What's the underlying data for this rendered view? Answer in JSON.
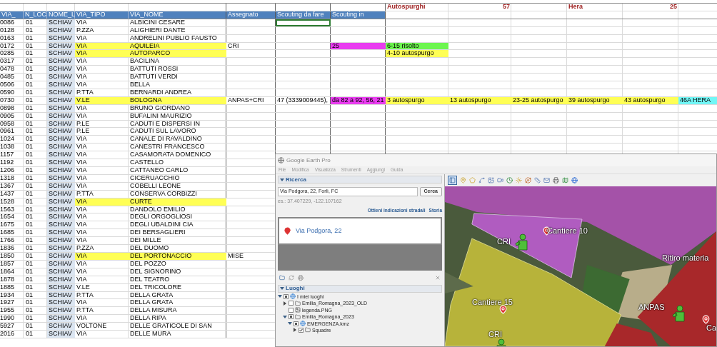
{
  "sheet": {
    "summary": [
      {
        "label": "Autospurghi",
        "count": "57"
      },
      {
        "label": "Hera",
        "count": "25"
      }
    ],
    "columns": [
      "VIA_",
      "N_LOC",
      "NOME_L",
      "VIA_TIPO",
      "VIA_NOME",
      "Assegnato",
      "Scouting da fare",
      "Scouting in"
    ],
    "rows": [
      {
        "codice": "0086",
        "loc": "01",
        "nome": "SCHIAV",
        "tipo": "VIA",
        "via": "ALBICINI CESARE",
        "highlighted": false,
        "selected": true
      },
      {
        "codice": "0128",
        "loc": "01",
        "nome": "SCHIAV",
        "tipo": "P.ZZA",
        "via": "ALIGHIERI DANTE",
        "highlighted": false,
        "selected": false
      },
      {
        "codice": "0163",
        "loc": "01",
        "nome": "SCHIAV",
        "tipo": "VIA",
        "via": "ANDRELINI PUBLIO FAUSTO",
        "highlighted": false,
        "selected": false
      },
      {
        "codice": "0172",
        "loc": "01",
        "nome": "SCHIAV",
        "tipo": "VIA",
        "via": "AQUILEIA",
        "highlighted": true,
        "selected": false,
        "assegnato": "CRI",
        "scouting_in": "25",
        "interventi": [
          {
            "text": "6-15 risolto",
            "color": "#6df64f"
          }
        ]
      },
      {
        "codice": "0285",
        "loc": "01",
        "nome": "SCHIAV",
        "tipo": "VIA",
        "via": "AUTOPARCO",
        "highlighted": true,
        "selected": false,
        "interventi": [
          {
            "text": "4-10 autospurgo",
            "color": "#ffff55"
          }
        ]
      },
      {
        "codice": "0317",
        "loc": "01",
        "nome": "SCHIAV",
        "tipo": "VIA",
        "via": "BACILINA",
        "highlighted": false,
        "selected": false
      },
      {
        "codice": "0478",
        "loc": "01",
        "nome": "SCHIAV",
        "tipo": "VIA",
        "via": "BATTUTI ROSSI",
        "highlighted": false,
        "selected": false
      },
      {
        "codice": "0485",
        "loc": "01",
        "nome": "SCHIAV",
        "tipo": "VIA",
        "via": "BATTUTI VERDI",
        "highlighted": false,
        "selected": false
      },
      {
        "codice": "0506",
        "loc": "01",
        "nome": "SCHIAV",
        "tipo": "VIA",
        "via": "BELLA",
        "highlighted": false,
        "selected": false
      },
      {
        "codice": "0590",
        "loc": "01",
        "nome": "SCHIAV",
        "tipo": "P.TTA",
        "via": "BERNARDI ANDREA",
        "highlighted": false,
        "selected": false
      },
      {
        "codice": "0730",
        "loc": "01",
        "nome": "SCHIAV",
        "tipo": "V.LE",
        "via": "BOLOGNA",
        "highlighted": true,
        "selected": false,
        "assegnato": "ANPAS+CRI",
        "da_fare": "47 (3339009445),",
        "scouting_in": "da 82 a 92, 56, 21",
        "interventi": [
          {
            "text": "3 autospurgo",
            "color": "#ffff55"
          },
          {
            "text": "13 autospurgo",
            "color": "#ffff55"
          },
          {
            "text": "23-25 autospurgo",
            "color": "#ffff55"
          },
          {
            "text": "39 autospurgo",
            "color": "#ffff55"
          },
          {
            "text": "43 autospurgo",
            "color": "#ffff55"
          },
          {
            "text": "46A HERA",
            "color": "#72f6f6"
          }
        ]
      },
      {
        "codice": "0898",
        "loc": "01",
        "nome": "SCHIAV",
        "tipo": "VIA",
        "via": "BRUNO GIORDANO",
        "highlighted": false,
        "selected": false
      },
      {
        "codice": "0905",
        "loc": "01",
        "nome": "SCHIAV",
        "tipo": "VIA",
        "via": "BUFALINI MAURIZIO",
        "highlighted": false,
        "selected": false
      },
      {
        "codice": "0958",
        "loc": "01",
        "nome": "SCHIAV",
        "tipo": "P.LE",
        "via": "CADUTI E DISPERSI IN",
        "highlighted": false,
        "selected": false
      },
      {
        "codice": "0961",
        "loc": "01",
        "nome": "SCHIAV",
        "tipo": "P.LE",
        "via": "CADUTI SUL LAVORO",
        "highlighted": false,
        "selected": false
      },
      {
        "codice": "1024",
        "loc": "01",
        "nome": "SCHIAV",
        "tipo": "VIA",
        "via": "CANALE DI RAVALDINO",
        "highlighted": false,
        "selected": false
      },
      {
        "codice": "1038",
        "loc": "01",
        "nome": "SCHIAV",
        "tipo": "VIA",
        "via": "CANESTRI FRANCESCO",
        "highlighted": false,
        "selected": false
      },
      {
        "codice": "1157",
        "loc": "01",
        "nome": "SCHIAV",
        "tipo": "VIA",
        "via": "CASAMORATA DOMENICO",
        "highlighted": false,
        "selected": false
      },
      {
        "codice": "1192",
        "loc": "01",
        "nome": "SCHIAV",
        "tipo": "VIA",
        "via": "CASTELLO",
        "highlighted": false,
        "selected": false
      },
      {
        "codice": "1206",
        "loc": "01",
        "nome": "SCHIAV",
        "tipo": "VIA",
        "via": "CATTANEO CARLO",
        "highlighted": false,
        "selected": false
      },
      {
        "codice": "1318",
        "loc": "01",
        "nome": "SCHIAV",
        "tipo": "VIA",
        "via": "CICERUACCHIO",
        "highlighted": false,
        "selected": false
      },
      {
        "codice": "1367",
        "loc": "01",
        "nome": "SCHIAV",
        "tipo": "VIA",
        "via": "COBELLI LEONE",
        "highlighted": false,
        "selected": false
      },
      {
        "codice": "1437",
        "loc": "01",
        "nome": "SCHIAV",
        "tipo": "P.TTA",
        "via": "CONSERVA CORBIZZI",
        "highlighted": false,
        "selected": false
      },
      {
        "codice": "1528",
        "loc": "01",
        "nome": "SCHIAV",
        "tipo": "VIA",
        "via": "CURTE",
        "highlighted": true,
        "selected": false
      },
      {
        "codice": "1563",
        "loc": "01",
        "nome": "SCHIAV",
        "tipo": "VIA",
        "via": "DANDOLO EMILIO",
        "highlighted": false,
        "selected": false
      },
      {
        "codice": "1654",
        "loc": "01",
        "nome": "SCHIAV",
        "tipo": "VIA",
        "via": "DEGLI ORGOGLIOSI",
        "highlighted": false,
        "selected": false
      },
      {
        "codice": "1675",
        "loc": "01",
        "nome": "SCHIAV",
        "tipo": "VIA",
        "via": "DEGLI UBALDINI CIA",
        "highlighted": false,
        "selected": false
      },
      {
        "codice": "1685",
        "loc": "01",
        "nome": "SCHIAV",
        "tipo": "VIA",
        "via": "DEI BERSAGLIERI",
        "highlighted": false,
        "selected": false
      },
      {
        "codice": "1766",
        "loc": "01",
        "nome": "SCHIAV",
        "tipo": "VIA",
        "via": "DEI MILLE",
        "highlighted": false,
        "selected": false
      },
      {
        "codice": "1836",
        "loc": "01",
        "nome": "SCHIAV",
        "tipo": "P.ZZA",
        "via": "DEL DUOMO",
        "highlighted": false,
        "selected": false
      },
      {
        "codice": "1850",
        "loc": "01",
        "nome": "SCHIAV",
        "tipo": "VIA",
        "via": "DEL PORTONACCIO",
        "highlighted": true,
        "selected": false,
        "assegnato": "MISE"
      },
      {
        "codice": "1857",
        "loc": "01",
        "nome": "SCHIAV",
        "tipo": "VIA",
        "via": "DEL POZZO",
        "highlighted": false,
        "selected": false
      },
      {
        "codice": "1864",
        "loc": "01",
        "nome": "SCHIAV",
        "tipo": "VIA",
        "via": "DEL SIGNORINO",
        "highlighted": false,
        "selected": false
      },
      {
        "codice": "1878",
        "loc": "01",
        "nome": "SCHIAV",
        "tipo": "VIA",
        "via": "DEL TEATRO",
        "highlighted": false,
        "selected": false
      },
      {
        "codice": "1885",
        "loc": "01",
        "nome": "SCHIAV",
        "tipo": "V.LE",
        "via": "DEL TRICOLORE",
        "highlighted": false,
        "selected": false
      },
      {
        "codice": "1934",
        "loc": "01",
        "nome": "SCHIAV",
        "tipo": "P.TTA",
        "via": "DELLA GRATA",
        "highlighted": false,
        "selected": false
      },
      {
        "codice": "1927",
        "loc": "01",
        "nome": "SCHIAV",
        "tipo": "VIA",
        "via": "DELLA GRATA",
        "highlighted": false,
        "selected": false
      },
      {
        "codice": "1955",
        "loc": "01",
        "nome": "SCHIAV",
        "tipo": "P.TTA",
        "via": "DELLA MISURA",
        "highlighted": false,
        "selected": false
      },
      {
        "codice": "1990",
        "loc": "01",
        "nome": "SCHIAV",
        "tipo": "VIA",
        "via": "DELLA RIPA",
        "highlighted": false,
        "selected": false
      },
      {
        "codice": "5927",
        "loc": "01",
        "nome": "SCHIAV",
        "tipo": "VOLTONE",
        "via": "DELLE GRATICOLE DI SAN",
        "highlighted": false,
        "selected": false
      },
      {
        "codice": "2016",
        "loc": "01",
        "nome": "SCHIAV",
        "tipo": "VIA",
        "via": "DELLE MURA",
        "highlighted": false,
        "selected": false
      }
    ]
  },
  "earth": {
    "title": "Google Earth Pro",
    "menu": [
      "File",
      "Modifica",
      "Visualizza",
      "Strumenti",
      "Aggiungi",
      "Guida"
    ],
    "search": {
      "title": "Ricerca",
      "expanded": true,
      "value": "Via Podgora, 22, Forlì, FC",
      "button": "Cerca",
      "hint": "es.: 37.407229, -122.107162",
      "links": [
        "Ottieni indicazioni stradali",
        "Storia"
      ],
      "result": "Via Podgora, 22"
    },
    "places": {
      "title": "Luoghi",
      "expanded": true,
      "items": [
        {
          "label": "I miei luoghi",
          "kind": "globe",
          "checked": true,
          "mixed": true,
          "expanded": true,
          "children": [
            {
              "label": "Emilia_Romagna_2023_OLD",
              "kind": "folder",
              "checked": false,
              "mixed": false,
              "expanded": false
            },
            {
              "label": "legenda.PNG",
              "kind": "image",
              "checked": false,
              "mixed": false
            },
            {
              "label": "Emilia_Romagna_2023",
              "kind": "folder",
              "checked": true,
              "mixed": true,
              "expanded": true,
              "children": [
                {
                  "label": "EMERGENZA.kmz",
                  "kind": "globe",
                  "checked": true,
                  "mixed": true,
                  "expanded": true,
                  "children": [
                    {
                      "label": "Squadre",
                      "kind": "folder",
                      "checked": true,
                      "mixed": false,
                      "expanded": false
                    }
                  ]
                }
              ]
            }
          ]
        }
      ]
    },
    "toolbar": {
      "sidebar_selected": true
    },
    "map_labels": [
      {
        "kind": "pin",
        "text": "Cantiere 10"
      },
      {
        "kind": "team",
        "text": "CRI"
      },
      {
        "kind": "plain",
        "text": "Ritiro materia"
      },
      {
        "kind": "pin",
        "text": "Cantiere 15"
      },
      {
        "kind": "team",
        "text": "ANPAS"
      },
      {
        "kind": "pin",
        "text": "Ca"
      },
      {
        "kind": "team",
        "text": "CRI"
      }
    ]
  }
}
